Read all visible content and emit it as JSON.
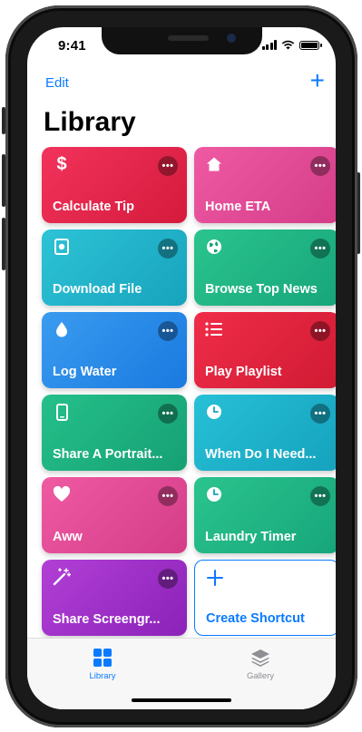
{
  "status_bar": {
    "time": "9:41"
  },
  "nav": {
    "edit_label": "Edit",
    "add_label": "+"
  },
  "page": {
    "title": "Library"
  },
  "shortcuts": [
    {
      "label": "Calculate Tip",
      "icon": "dollar-icon",
      "color_from": "#f2335c",
      "color_to": "#d51a3c"
    },
    {
      "label": "Home ETA",
      "icon": "house-icon",
      "color_from": "#ef5aa3",
      "color_to": "#d43c88"
    },
    {
      "label": "Download File",
      "icon": "disk-icon",
      "color_from": "#2dc3d6",
      "color_to": "#17a3bd"
    },
    {
      "label": "Browse Top News",
      "icon": "globe-icon",
      "color_from": "#2bc48e",
      "color_to": "#16a57a"
    },
    {
      "label": "Log Water",
      "icon": "drop-icon",
      "color_from": "#3a9bf0",
      "color_to": "#1a7ae0"
    },
    {
      "label": "Play Playlist",
      "icon": "list-icon",
      "color_from": "#f02d49",
      "color_to": "#d01a33"
    },
    {
      "label": "Share A Portrait...",
      "icon": "phone-icon",
      "color_from": "#25c08a",
      "color_to": "#16a074"
    },
    {
      "label": "When Do I Need...",
      "icon": "clock-icon",
      "color_from": "#27c0d6",
      "color_to": "#15a2bd"
    },
    {
      "label": "Aww",
      "icon": "heart-icon",
      "color_from": "#ef5aa3",
      "color_to": "#d43c88"
    },
    {
      "label": "Laundry Timer",
      "icon": "clock-icon",
      "color_from": "#2bc48e",
      "color_to": "#16a57a"
    },
    {
      "label": "Share Screengr...",
      "icon": "magic-wand-icon",
      "color_from": "#b23fd6",
      "color_to": "#8b22b8"
    }
  ],
  "create_card": {
    "label": "Create Shortcut",
    "icon": "plus-icon"
  },
  "tabs": [
    {
      "label": "Library",
      "color": "#0a7aff"
    },
    {
      "label": "Gallery",
      "color": "#8e8e93"
    }
  ]
}
